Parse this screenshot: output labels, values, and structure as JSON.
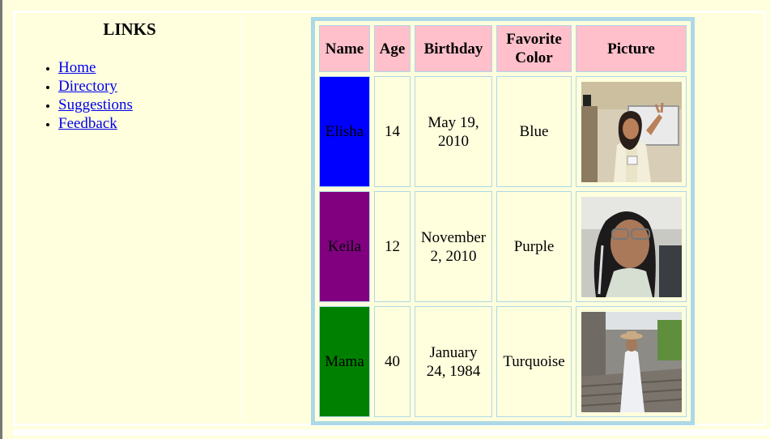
{
  "sidebar": {
    "heading": "LINKS",
    "links": [
      {
        "label": "Home"
      },
      {
        "label": "Directory"
      },
      {
        "label": "Suggestions"
      },
      {
        "label": "Feedback"
      }
    ]
  },
  "table": {
    "headers": [
      "Name",
      "Age",
      "Birthday",
      "Favorite Color",
      "Picture"
    ],
    "rows": [
      {
        "name": "Elisha",
        "age": "14",
        "birthday": "May 19, 2010",
        "color": "Blue",
        "name_bg": "#0000ff"
      },
      {
        "name": "Keila",
        "age": "12",
        "birthday": "November 2, 2010",
        "color": "Purple",
        "name_bg": "#800080"
      },
      {
        "name": "Mama",
        "age": "40",
        "birthday": "January 24, 1984",
        "color": "Turquoise",
        "name_bg": "#008000"
      }
    ]
  },
  "colors": {
    "page_bg": "#ffffde",
    "header_bg": "#ffc0cb",
    "table_border": "#add8e6",
    "link": "#0000ee"
  }
}
